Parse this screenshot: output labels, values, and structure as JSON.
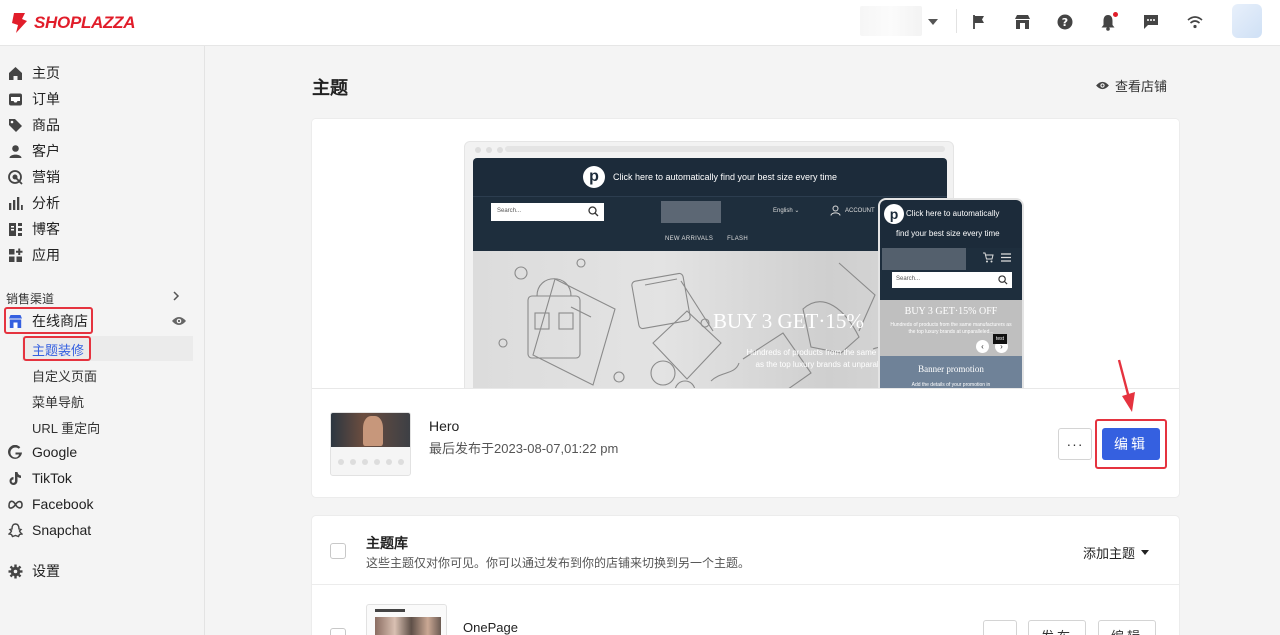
{
  "brand": {
    "name": "SHOPLAZZA",
    "color": "#e11d2a"
  },
  "topbar": {
    "icons": [
      "flag-icon",
      "store-icon",
      "help-icon",
      "bell-icon",
      "chat-icon",
      "wifi-icon"
    ]
  },
  "sidebar": {
    "items": [
      {
        "label": "主页",
        "icon": "home-icon"
      },
      {
        "label": "订单",
        "icon": "inbox-icon"
      },
      {
        "label": "商品",
        "icon": "tag-icon"
      },
      {
        "label": "客户",
        "icon": "person-icon"
      },
      {
        "label": "营销",
        "icon": "target-icon"
      },
      {
        "label": "分析",
        "icon": "bar-chart-icon"
      },
      {
        "label": "博客",
        "icon": "blog-icon"
      },
      {
        "label": "应用",
        "icon": "apps-icon"
      }
    ],
    "section_label": "销售渠道",
    "online_store": "在线商店",
    "sub_items": [
      "主题装修",
      "自定义页面",
      "菜单导航",
      "URL 重定向"
    ],
    "channels": [
      {
        "label": "Google",
        "icon": "google-icon"
      },
      {
        "label": "TikTok",
        "icon": "tiktok-icon"
      },
      {
        "label": "Facebook",
        "icon": "meta-icon"
      },
      {
        "label": "Snapchat",
        "icon": "snapchat-icon"
      }
    ],
    "settings": "设置"
  },
  "main": {
    "title": "主题",
    "view_store": "查看店铺",
    "preview": {
      "announcement": "Click here to automatically find your best size every time",
      "search_placeholder": "Search...",
      "language": "English",
      "account": "ACCOUNT",
      "nav": [
        "NEW ARRIVALS",
        "FLASH"
      ],
      "hero_title": "BUY 3 GET·15%",
      "hero_sub_1": "Hundreds of products from the same ma",
      "hero_sub_2": "as the top luxury brands at unparall",
      "mobile_announcement_1": "Click here to automatically",
      "mobile_announcement_2": "find your best size every time",
      "mobile_search": "Search...",
      "mobile_hero_title": "BUY 3 GET·15% OFF",
      "mobile_hero_sub": "Hundreds of products from the same manufacturers as the top luxury brands at unparalleled...",
      "mobile_test": "test",
      "banner_title": "Banner promotion",
      "banner_sub": "Add the details of your promotion in"
    },
    "current_theme": {
      "name": "Hero",
      "published": "最后发布于2023-08-07,01:22 pm",
      "more": "···",
      "edit": "编辑"
    },
    "library": {
      "title": "主题库",
      "description": "这些主题仅对你可见。你可以通过发布到你的店铺来切换到另一个主题。",
      "add_theme": "添加主题",
      "themes": [
        {
          "name": "OnePage",
          "publish": "发布",
          "edit": "编辑"
        }
      ]
    }
  },
  "colors": {
    "accent": "#3560e0",
    "highlight": "#e5333f",
    "active_link": "#3560e0"
  }
}
